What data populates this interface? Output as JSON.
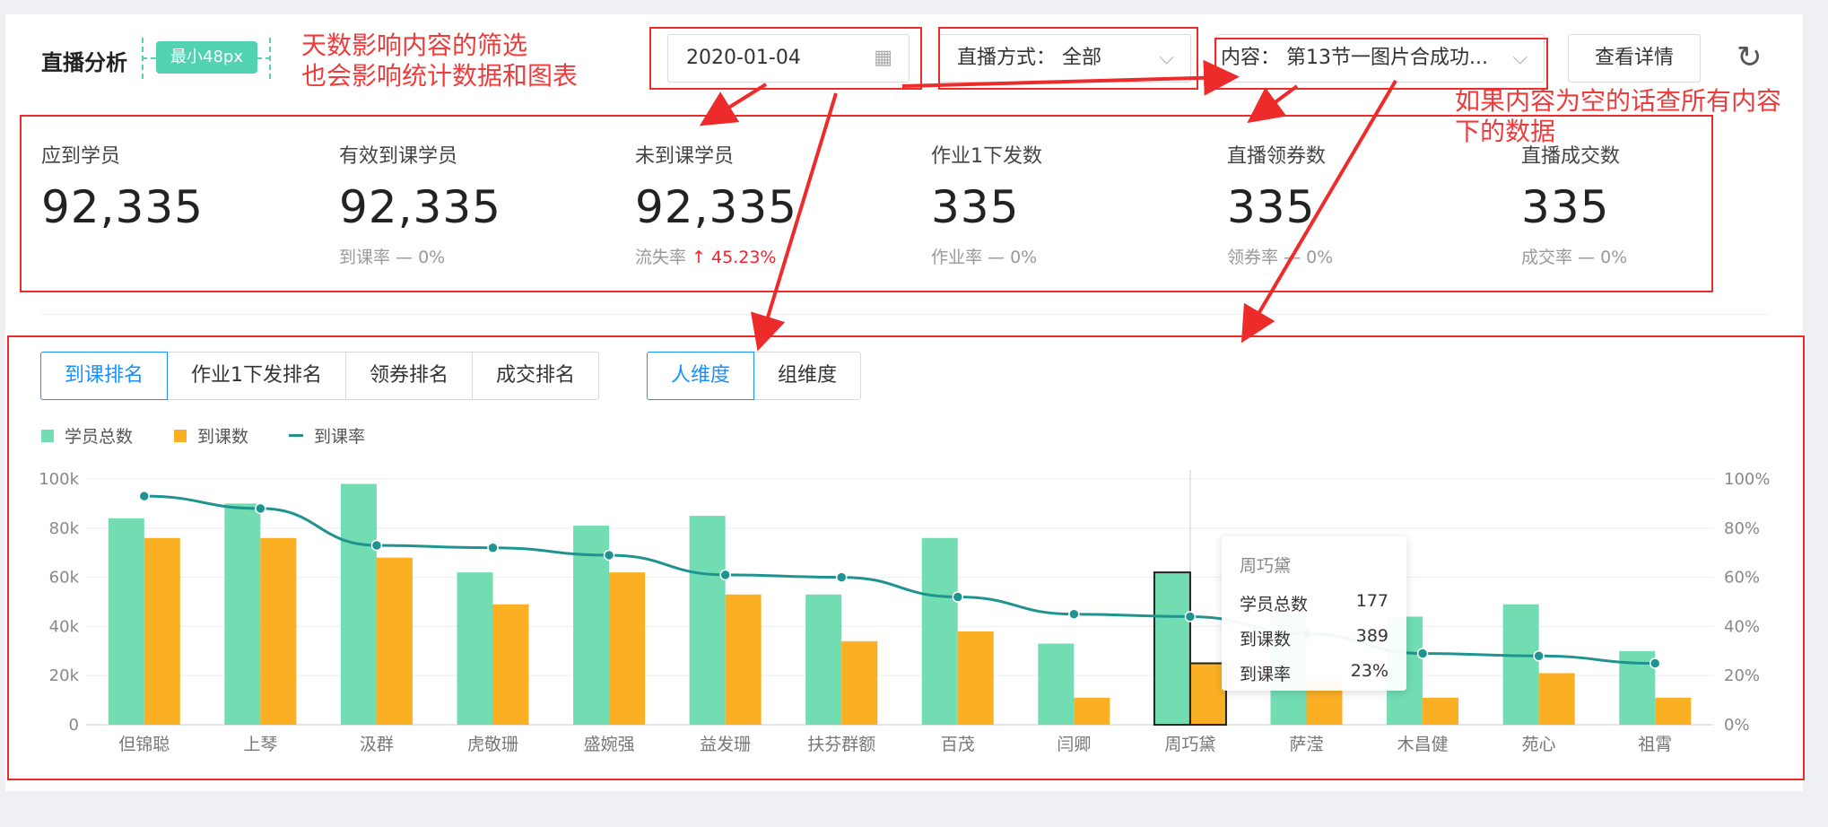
{
  "header": {
    "title": "直播分析",
    "size_badge": "最小48px",
    "date_value": "2020-01-04",
    "mode_filter": "直播方式： 全部",
    "content_filter": "内容： 第13节一图片合成功...",
    "detail_button": "查看详情"
  },
  "annotations": {
    "date_note_line1": "天数影响内容的筛选",
    "date_note_line2": "也会影响统计数据和图表",
    "content_note_line1": "如果内容为空的话查所有内容",
    "content_note_line2": "下的数据"
  },
  "stats": [
    {
      "label": "应到学员",
      "value": "92,335",
      "sub": ""
    },
    {
      "label": "有效到课学员",
      "value": "92,335",
      "sub": "到课率 — 0%"
    },
    {
      "label": "未到课学员",
      "value": "92,335",
      "sub_label": "流失率",
      "sub_value": "↑ 45.23%"
    },
    {
      "label": "作业1下发数",
      "value": "335",
      "sub": "作业率 — 0%"
    },
    {
      "label": "直播领券数",
      "value": "335",
      "sub": "领券率 — 0%"
    },
    {
      "label": "直播成交数",
      "value": "335",
      "sub": "成交率 — 0%"
    }
  ],
  "rank_tabs": [
    "到课排名",
    "作业1下发排名",
    "领券排名",
    "成交排名"
  ],
  "dim_tabs": [
    "人维度",
    "组维度"
  ],
  "legend": {
    "total": "学员总数",
    "attend": "到课数",
    "rate": "到课率"
  },
  "colors": {
    "total": "#72ddb3",
    "attend": "#fbb024",
    "rate": "#1f9390",
    "annotation": "#ee2b2b",
    "active": "#1890ff"
  },
  "tooltip": {
    "title": "周巧黛",
    "rows": [
      {
        "label": "学员总数",
        "value": "177"
      },
      {
        "label": "到课数",
        "value": "389"
      },
      {
        "label": "到课率",
        "value": "23%"
      }
    ]
  },
  "chart_data": {
    "type": "bar",
    "categories": [
      "但锦聪",
      "上琴",
      "汲群",
      "虎敬珊",
      "盛婉强",
      "益发珊",
      "扶芬群额",
      "百茂",
      "闫卿",
      "周巧黛",
      "萨滢",
      "木昌健",
      "苑心",
      "祖霄"
    ],
    "series": [
      {
        "name": "学员总数",
        "type": "bar",
        "axis": "left",
        "values": [
          84000,
          90000,
          98000,
          62000,
          81000,
          85000,
          53000,
          76000,
          33000,
          62000,
          45000,
          44000,
          49000,
          30000
        ]
      },
      {
        "name": "到课数",
        "type": "bar",
        "axis": "left",
        "values": [
          76000,
          76000,
          68000,
          49000,
          62000,
          53000,
          34000,
          38000,
          11000,
          25000,
          18000,
          11000,
          21000,
          11000
        ]
      },
      {
        "name": "到课率",
        "type": "line",
        "axis": "right",
        "values": [
          93,
          88,
          73,
          72,
          69,
          61,
          60,
          52,
          45,
          44,
          37,
          29,
          28,
          25
        ]
      }
    ],
    "y_left": {
      "min": 0,
      "max": 100000,
      "ticks": [
        "0",
        "20k",
        "40k",
        "60k",
        "80k",
        "100k"
      ]
    },
    "y_right": {
      "min": 0,
      "max": 100,
      "ticks": [
        "0%",
        "20%",
        "40%",
        "60%",
        "80%",
        "100%"
      ]
    },
    "highlight_index": 9,
    "grid": true
  }
}
